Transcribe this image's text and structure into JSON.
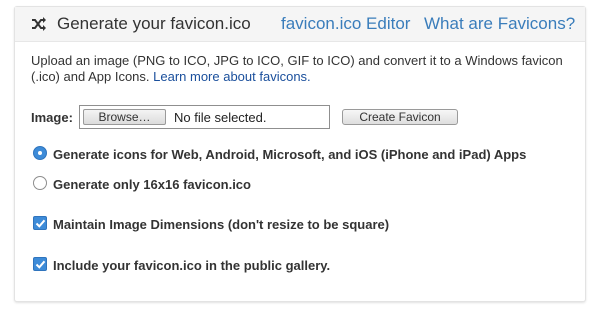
{
  "header": {
    "icon": "shuffle-icon",
    "title": "Generate your favicon.ico",
    "links": [
      "favicon.ico Editor",
      "What are Favicons?"
    ]
  },
  "intro": {
    "text": "Upload an image (PNG to ICO, JPG to ICO, GIF to ICO) and convert it to a Windows favicon (.ico) and App Icons. ",
    "link": "Learn more about favicons."
  },
  "upload": {
    "label": "Image:",
    "browse_label": "Browse…",
    "file_status": "No file selected.",
    "create_label": "Create Favicon"
  },
  "options": {
    "radio_all": {
      "label": "Generate icons for Web, Android, Microsoft, and iOS (iPhone and iPad) Apps",
      "selected": true
    },
    "radio_16": {
      "label": "Generate only 16x16 favicon.ico",
      "selected": false
    },
    "maintain_dimensions": {
      "label": "Maintain Image Dimensions (don't resize to be square)",
      "checked": true
    },
    "public_gallery": {
      "label": "Include your favicon.ico in the public gallery.",
      "checked": true
    }
  },
  "colors": {
    "link": "#3a7dbb",
    "accent": "#3d8bd8",
    "header_bg": "#f5f5f5",
    "text": "#333333"
  }
}
